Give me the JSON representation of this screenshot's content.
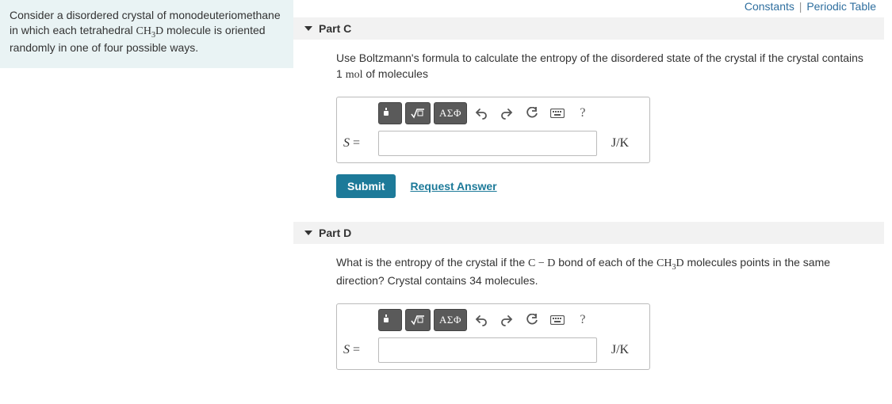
{
  "top_links": {
    "constants": "Constants",
    "periodic_table": "Periodic Table"
  },
  "problem": {
    "text_before": "Consider a disordered crystal of monodeuteriomethane in which each tetrahedral ",
    "formula_base": "CH",
    "formula_sub": "3",
    "formula_end": "D",
    "text_after": " molecule is oriented randomly in one of four possible ways."
  },
  "parts": {
    "c": {
      "title": "Part C",
      "prompt_before": "Use Boltzmann's formula to calculate the entropy of the disordered state of the crystal if the crystal contains 1 ",
      "prompt_unit": "mol",
      "prompt_after": " of molecules",
      "input_label": "S",
      "unit_label": "J/K",
      "submit": "Submit",
      "request": "Request Answer",
      "answer_value": ""
    },
    "d": {
      "title": "Part D",
      "prompt_before": "What is the entropy of the crystal if the ",
      "bond_left": "C",
      "bond_dash": " − ",
      "bond_right": "D",
      "prompt_mid": " bond of each of the ",
      "formula_base": "CH",
      "formula_sub": "3",
      "formula_end": "D",
      "prompt_after": " molecules points in the same direction? Crystal contains 34 molecules.",
      "input_label": "S",
      "unit_label": "J/K",
      "answer_value": ""
    }
  },
  "toolbar": {
    "greek": "ΑΣΦ",
    "help": "?"
  }
}
